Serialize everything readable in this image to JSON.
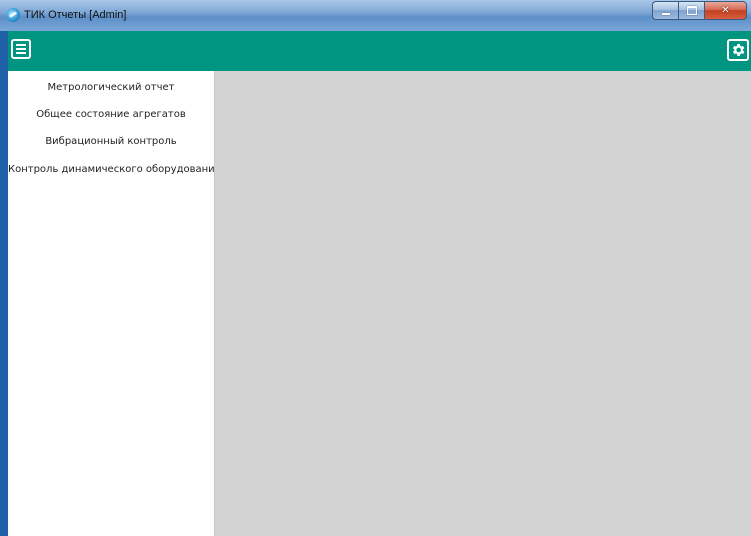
{
  "window": {
    "title": "ТИК Отчеты [Admin]"
  },
  "appbar": {
    "menu_icon": "hamburger-menu-icon",
    "settings_icon": "gear-icon",
    "color": "#009580"
  },
  "sidebar": {
    "items": [
      {
        "label": "Метрологический отчет"
      },
      {
        "label": "Общее состояние агрегатов"
      },
      {
        "label": "Вибрационный контроль"
      },
      {
        "label": "Контроль динамического оборудования"
      }
    ]
  }
}
